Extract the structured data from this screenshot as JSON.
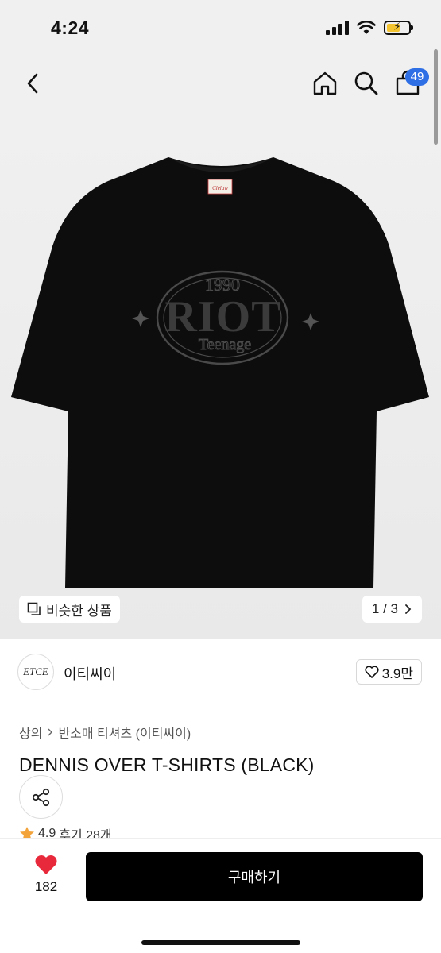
{
  "status_bar": {
    "time": "4:24"
  },
  "header": {
    "cart_count": "49"
  },
  "gallery": {
    "similar_label": "비슷한 상품",
    "page_indicator": "1 / 3",
    "print_text": {
      "year": "1990",
      "main": "RIOT",
      "sub": "Teenage"
    },
    "neck_label": "Clelaw"
  },
  "brand": {
    "logo_text": "ETCE",
    "name": "이티씨이",
    "likes": "3.9만"
  },
  "breadcrumb": {
    "category": "상의",
    "subcategory": "반소매 티셔츠 (이티씨이)"
  },
  "product": {
    "title": "DENNIS OVER T-SHIRTS (BLACK)"
  },
  "rating": {
    "score": "4.9",
    "reviews": "후기 28개"
  },
  "bottom_bar": {
    "fav_count": "182",
    "buy_label": "구매하기"
  },
  "colors": {
    "accent_blue": "#2f6fe6",
    "heart_red": "#e8283b",
    "star_orange": "#f2a33a",
    "shirt_black": "#0d0d0d"
  }
}
